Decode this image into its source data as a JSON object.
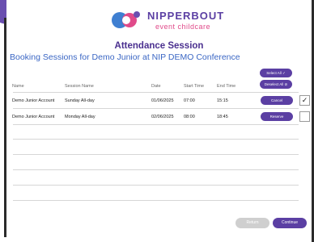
{
  "brand": {
    "name": "NIPPERBOUT",
    "tagline": "event childcare"
  },
  "page": {
    "title": "Attendance Session",
    "subtitle": "Booking Sessions for Demo Junior at NIP DEMO Conference"
  },
  "actions": {
    "select_all": "Select All ✓",
    "deselect_all": "Deselect All ⊘"
  },
  "table": {
    "headers": {
      "name": "Name",
      "session": "Session Name",
      "date": "Date",
      "start": "Start Time",
      "end": "End Time"
    },
    "rows": [
      {
        "name": "Demo Junior Account",
        "session": "Sunday All-day",
        "date": "01/06/2025",
        "start": "07:00",
        "end": "15:15",
        "action": "Cancel",
        "checked": "✓"
      },
      {
        "name": "Demo Junior Account",
        "session": "Monday All-day",
        "date": "02/06/2025",
        "start": "08:00",
        "end": "18:45",
        "action": "Reserve",
        "checked": ""
      }
    ]
  },
  "footer_buttons": {
    "return": "Return",
    "continue": "Continue"
  },
  "colors": {
    "accent": "#5b3fa3",
    "subtitle": "#3a66c4",
    "brand_pink": "#e04a8a"
  }
}
